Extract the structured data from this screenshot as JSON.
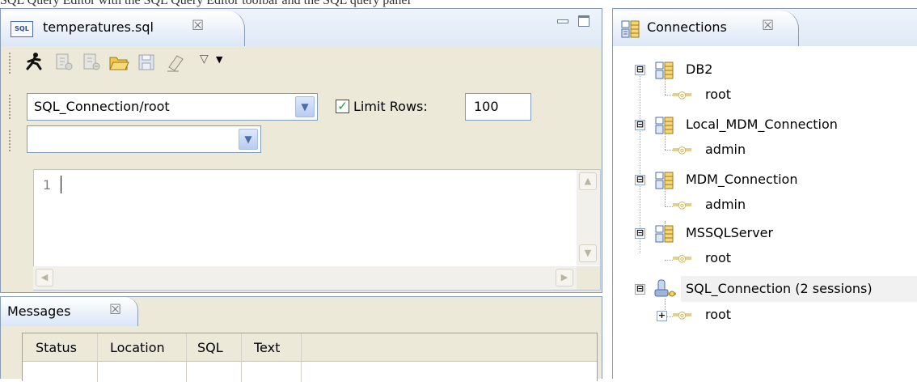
{
  "top_caption": "SQL Query Editor with the SQL Query Editor toolbar and the SQL query panel",
  "editor": {
    "tab_icon_text": "SQL",
    "tab_title": "temperatures.sql",
    "close_glyph": "☒",
    "connection_value": "SQL_Connection/root",
    "limit_rows_label": "Limit Rows:",
    "limit_rows_checked": "✓",
    "limit_rows_value": "100",
    "second_combo_value": "",
    "line_number": "1",
    "toolbar_icons": [
      "run-icon",
      "run-line-icon",
      "run-selection-icon",
      "open-file-icon",
      "save-icon",
      "clear-icon",
      "view-menu-icon",
      "dropdown-arrow-icon"
    ]
  },
  "messages": {
    "tab_title": "Messages",
    "close_glyph": "☒",
    "columns": [
      "Status",
      "Location",
      "SQL",
      "Text"
    ]
  },
  "connections": {
    "tab_title": "Connections",
    "close_glyph": "☒",
    "tree": [
      {
        "label": "DB2",
        "expanded": "⊟",
        "children": [
          "root"
        ]
      },
      {
        "label": "Local_MDM_Connection",
        "expanded": "⊟",
        "children": [
          "admin"
        ]
      },
      {
        "label": "MDM_Connection",
        "expanded": "⊟",
        "children": [
          "admin"
        ]
      },
      {
        "label": "MSSQLServer",
        "expanded": "⊟",
        "children": [
          "root"
        ]
      },
      {
        "label": "SQL_Connection (2 sessions)",
        "expanded": "⊟",
        "children": [
          "root"
        ]
      }
    ]
  },
  "colors": {
    "tab_gradient_top": "#ffffff",
    "tab_gradient_bottom": "#dbe6f6",
    "view_border": "#8a9cb5",
    "check_green": "#21a121",
    "user_icon_gold": "#c8a21e"
  }
}
